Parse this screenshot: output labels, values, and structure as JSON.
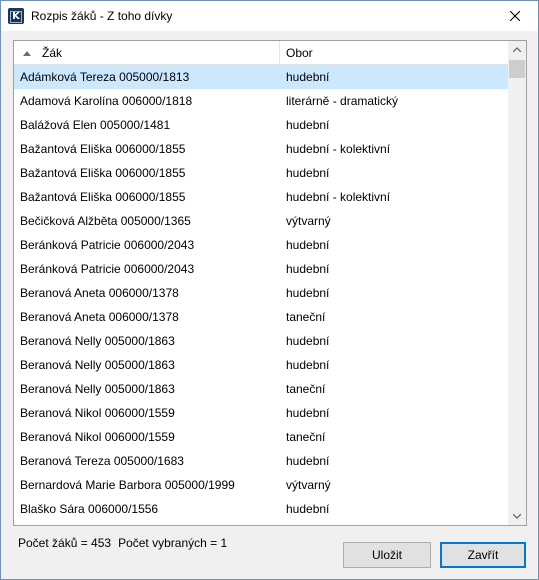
{
  "window": {
    "title": "Rozpis žáků - Z toho dívky",
    "app_icon_letter": "K"
  },
  "table": {
    "columns": [
      "Žák",
      "Obor"
    ],
    "rows": [
      {
        "name": "Adámková Tereza 005000/1813",
        "field": "hudební",
        "selected": true
      },
      {
        "name": "Adamová Karolína 006000/1818",
        "field": "literárně - dramatický"
      },
      {
        "name": "Balážová Elen 005000/1481",
        "field": "hudební"
      },
      {
        "name": "Bažantová Eliška 006000/1855",
        "field": "hudební - kolektivní"
      },
      {
        "name": "Bažantová Eliška 006000/1855",
        "field": "hudební"
      },
      {
        "name": "Bažantová Eliška 006000/1855",
        "field": "hudební - kolektivní"
      },
      {
        "name": "Bečičková Alžběta 005000/1365",
        "field": "výtvarný"
      },
      {
        "name": "Beránková Patricie 006000/2043",
        "field": "hudební"
      },
      {
        "name": "Beránková Patricie 006000/2043",
        "field": "hudební"
      },
      {
        "name": "Beranová Aneta 006000/1378",
        "field": "hudební"
      },
      {
        "name": "Beranová Aneta 006000/1378",
        "field": "taneční"
      },
      {
        "name": "Beranová Nelly 005000/1863",
        "field": "hudební"
      },
      {
        "name": "Beranová Nelly 005000/1863",
        "field": "hudební"
      },
      {
        "name": "Beranová Nelly 005000/1863",
        "field": "taneční"
      },
      {
        "name": "Beranová Nikol 006000/1559",
        "field": "hudební"
      },
      {
        "name": "Beranová Nikol 006000/1559",
        "field": "taneční"
      },
      {
        "name": "Beranová Tereza 005000/1683",
        "field": "hudební"
      },
      {
        "name": "Bernardová Marie Barbora 005000/1999",
        "field": "výtvarný"
      },
      {
        "name": "Blaško Sára 006000/1556",
        "field": "hudební"
      }
    ]
  },
  "status": {
    "total": "Počet žáků = 453",
    "selected": "Počet vybraných = 1"
  },
  "buttons": {
    "save": "Uložit",
    "close": "Zavřít"
  },
  "colors": {
    "selection": "#cce8ff",
    "default_button_border": "#0078d7"
  }
}
